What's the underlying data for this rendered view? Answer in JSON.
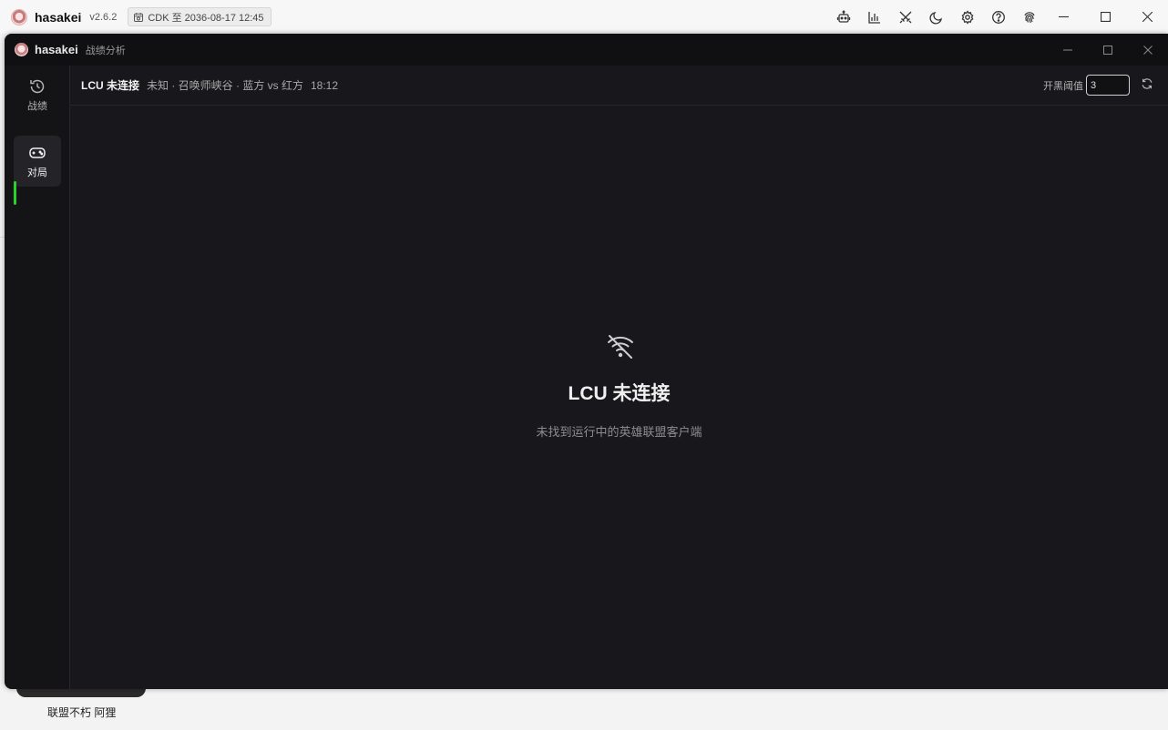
{
  "outer_window": {
    "app_name": "hasakei",
    "version": "v2.6.2",
    "cdk_label": "CDK 至 2036-08-17 12:45",
    "tools": [
      {
        "name": "robot-icon"
      },
      {
        "name": "bar-chart-icon"
      },
      {
        "name": "crossed-swords-icon"
      },
      {
        "name": "moon-icon"
      },
      {
        "name": "gear-icon"
      },
      {
        "name": "help-icon"
      },
      {
        "name": "fingerprint-icon"
      }
    ]
  },
  "dark_window": {
    "app_name": "hasakei",
    "subtitle": "战绩分析"
  },
  "sidebar": {
    "items": [
      {
        "label": "战绩",
        "icon": "history-icon",
        "active": false
      },
      {
        "label": "对局",
        "icon": "gamepad-icon",
        "active": true
      }
    ]
  },
  "header": {
    "status": "LCU 未连接",
    "match_info": "未知 · 召唤师峡谷 · 蓝方 vs 红方",
    "time": "18:12",
    "threshold_label": "开黑阈值",
    "threshold_value": "3"
  },
  "empty_state": {
    "icon": "wifi-off-icon",
    "title": "LCU 未连接",
    "description": "未找到运行中的英雄联盟客户端"
  },
  "background": {
    "caption": "联盟不朽 阿狸"
  },
  "colors": {
    "accent_green": "#2ad12a",
    "dark_bg": "#18181c"
  }
}
